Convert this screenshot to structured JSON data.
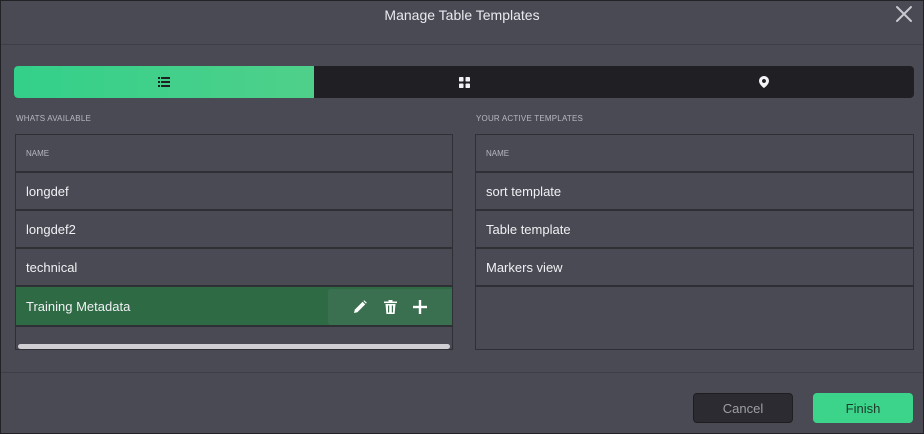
{
  "dialog": {
    "title": "Manage Table Templates"
  },
  "tabs": [
    {
      "icon": "list-icon",
      "active": true
    },
    {
      "icon": "grid-icon",
      "active": false
    },
    {
      "icon": "map-pin-icon",
      "active": false
    }
  ],
  "available": {
    "label": "WHATS AVAILABLE",
    "column": "NAME",
    "items": [
      {
        "label": "longdef"
      },
      {
        "label": "longdef2"
      },
      {
        "label": "technical"
      },
      {
        "label": "Training Metadata"
      }
    ],
    "selected_actions": [
      "pencil-icon",
      "trash-icon",
      "plus-icon"
    ]
  },
  "active": {
    "label": "YOUR ACTIVE TEMPLATES",
    "column": "NAME",
    "items": [
      {
        "label": "sort template"
      },
      {
        "label": "Table template"
      },
      {
        "label": "Markers view"
      }
    ]
  },
  "footer": {
    "cancel_label": "Cancel",
    "finish_label": "Finish"
  },
  "colors": {
    "accent": "#3bd48a",
    "selected_row": "#2e6b45",
    "dialog_bg": "#4a4a54"
  }
}
